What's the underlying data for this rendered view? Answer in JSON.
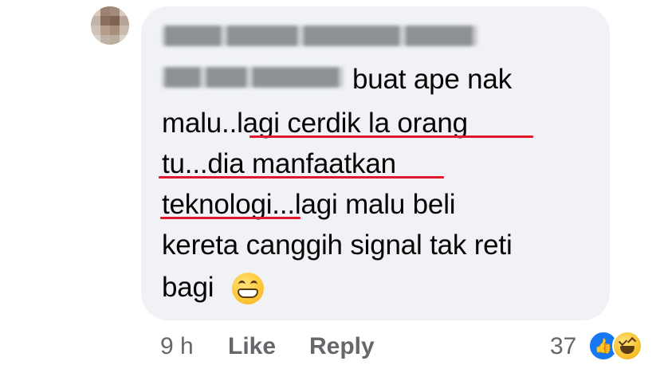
{
  "comment": {
    "author_name": "",
    "tagged_user": "",
    "lines": [
      "buat ape nak",
      "malu..lagi cerdik la orang",
      "tu...dia manfaatkan",
      "teknologi...lagi malu beli",
      "kereta canggih signal tak reti",
      "bagi"
    ],
    "emoji": "grinning-face-with-smiling-eyes"
  },
  "footer": {
    "time": "9 h",
    "like_label": "Like",
    "reply_label": "Reply",
    "reaction_count": "37",
    "reaction_types": [
      "like",
      "haha"
    ]
  },
  "colors": {
    "bubble_bg": "#f0f2f5",
    "text": "#050505",
    "meta_text": "#65676b",
    "annotation_underline": "#e0192e",
    "like_blue": "#1877f2"
  }
}
